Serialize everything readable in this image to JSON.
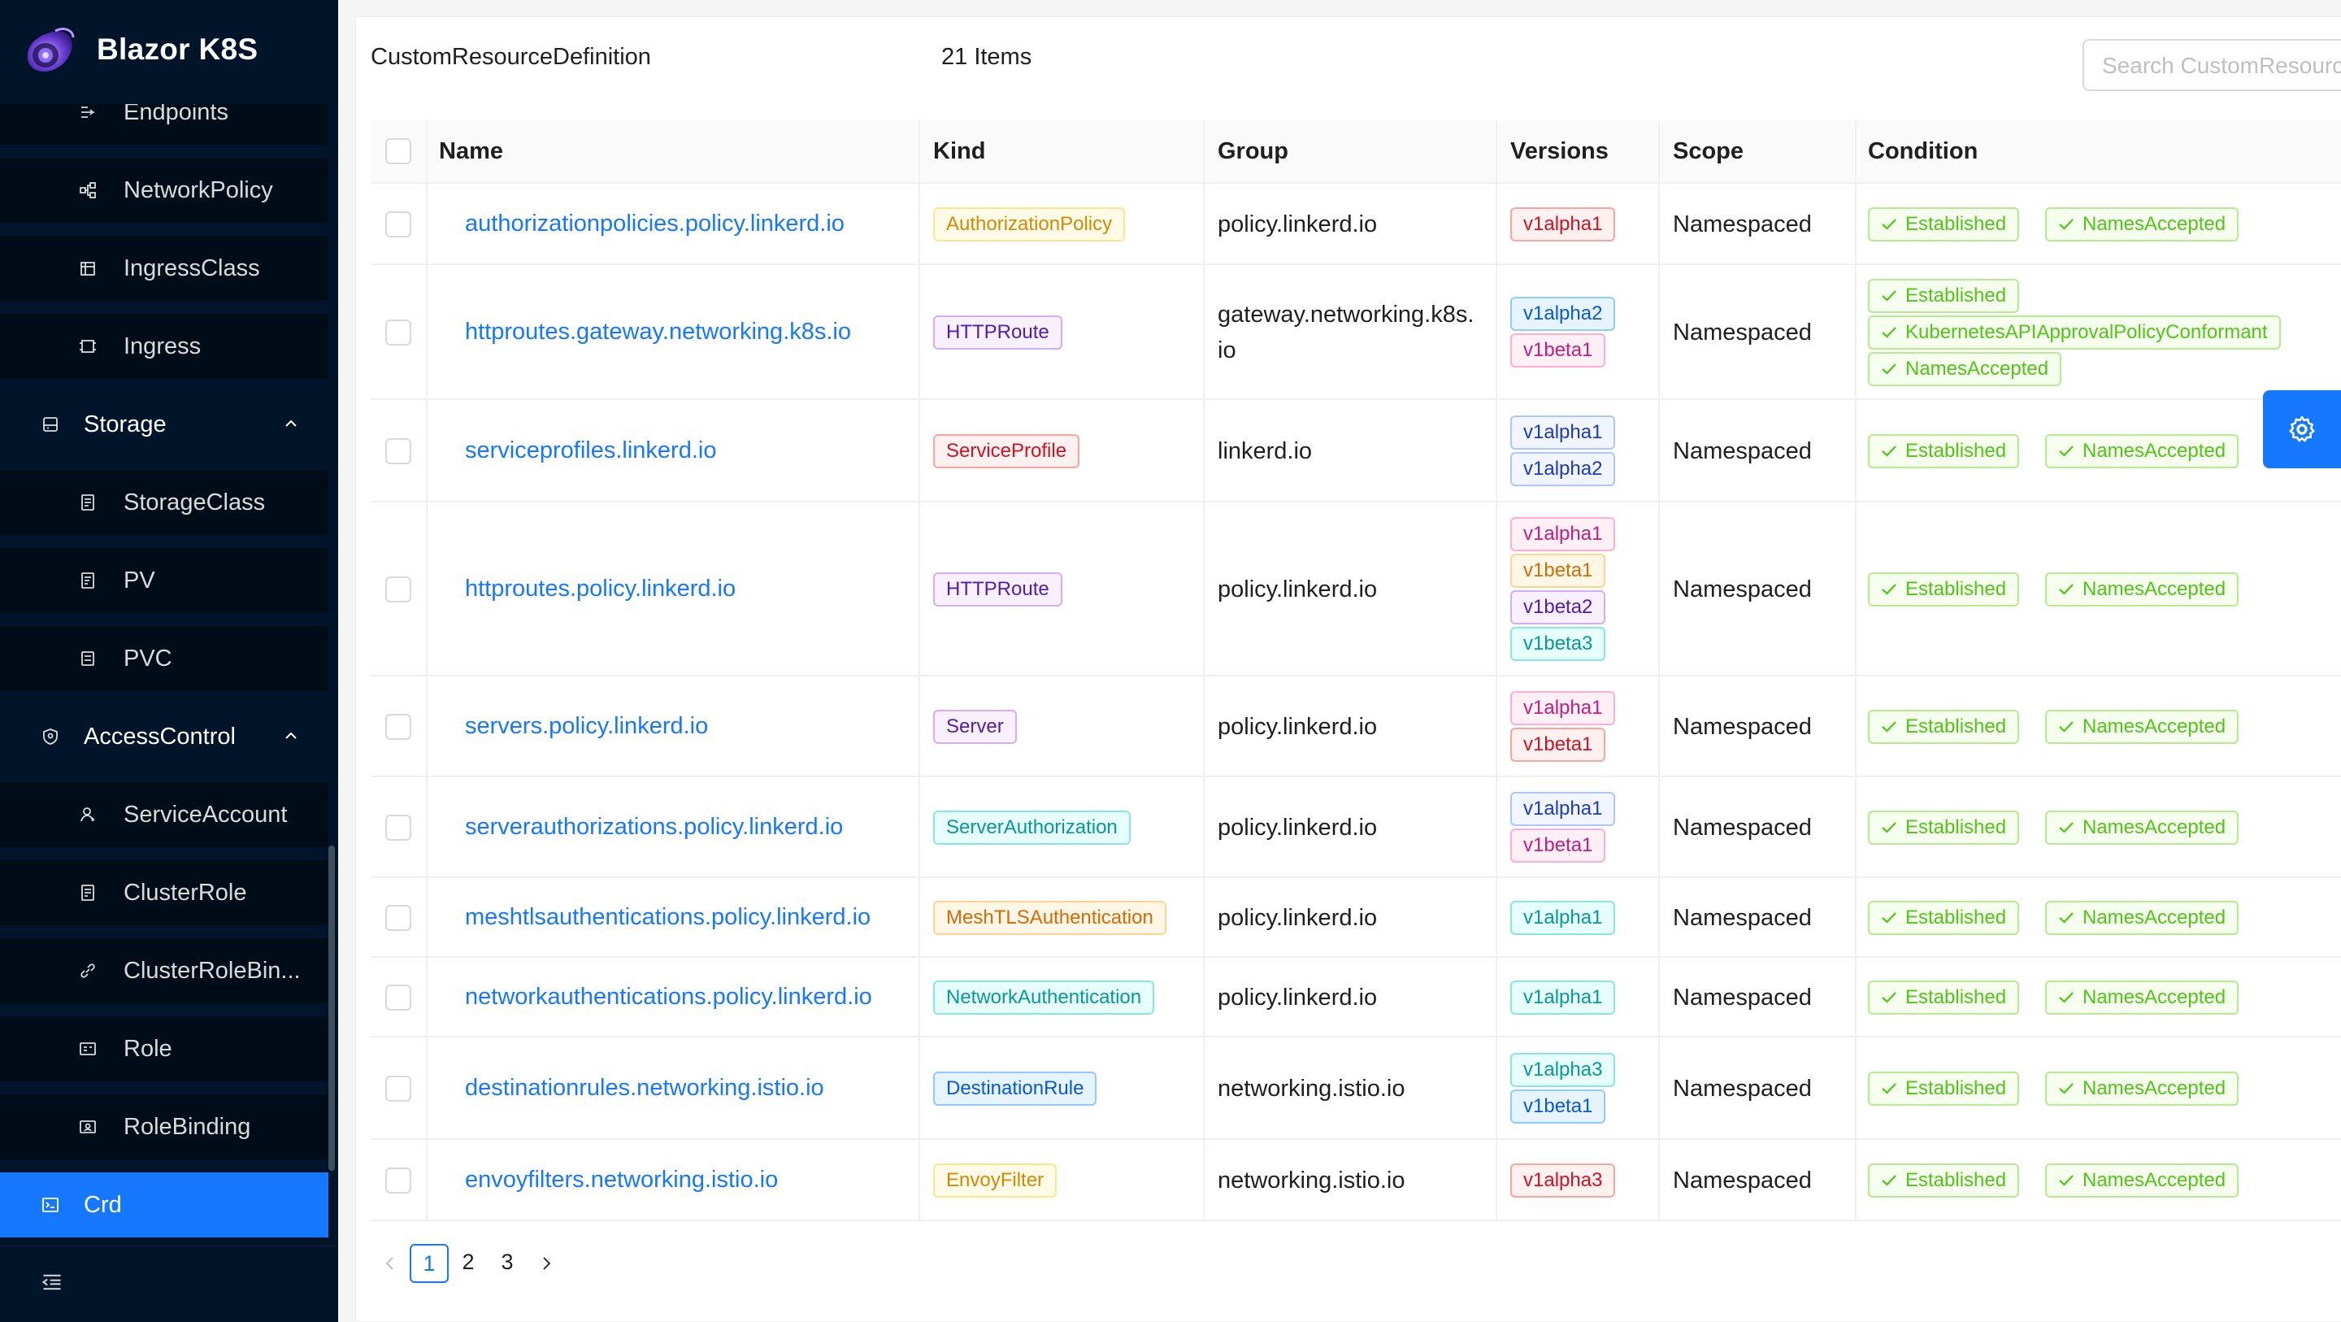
{
  "app": {
    "title": "Blazor K8S"
  },
  "sidebar": {
    "items": [
      {
        "label": "Endpoints",
        "icon": "endpoints-icon"
      },
      {
        "label": "NetworkPolicy",
        "icon": "network-policy-icon"
      },
      {
        "label": "IngressClass",
        "icon": "ingress-class-icon"
      },
      {
        "label": "Ingress",
        "icon": "ingress-icon"
      },
      {
        "label": "Storage",
        "icon": "storage-icon"
      },
      {
        "label": "StorageClass",
        "icon": "storage-class-icon"
      },
      {
        "label": "PV",
        "icon": "pv-icon"
      },
      {
        "label": "PVC",
        "icon": "pvc-icon"
      },
      {
        "label": "AccessControl",
        "icon": "access-control-icon"
      },
      {
        "label": "ServiceAccount",
        "icon": "service-account-icon"
      },
      {
        "label": "ClusterRole",
        "icon": "cluster-role-icon"
      },
      {
        "label": "ClusterRoleBin...",
        "icon": "cluster-role-binding-icon"
      },
      {
        "label": "Role",
        "icon": "role-icon"
      },
      {
        "label": "RoleBinding",
        "icon": "role-binding-icon"
      },
      {
        "label": "Crd",
        "icon": "crd-icon"
      }
    ],
    "selected": "Crd",
    "accent": "#1677ff",
    "background": "#001529"
  },
  "header": {
    "title": "CustomResourceDefinition",
    "count": "21 Items",
    "search_placeholder": "Search CustomResourceDefinition"
  },
  "table": {
    "columns": [
      "Name",
      "Kind",
      "Group",
      "Versions",
      "Scope",
      "Condition"
    ],
    "rows": [
      {
        "name": "authorizationpolicies.policy.linkerd.io",
        "kind": "AuthorizationPolicy",
        "group": [
          "policy.linkerd.io"
        ],
        "versions": [
          "v1alpha1"
        ],
        "scope": "Namespaced",
        "conditions": [
          "Established",
          "NamesAccepted"
        ]
      },
      {
        "name": "httproutes.gateway.networking.k8s.io",
        "kind": "HTTPRoute",
        "group": [
          "gateway.networking.k8s.",
          "io"
        ],
        "versions": [
          "v1alpha2",
          "v1beta1"
        ],
        "scope": "Namespaced",
        "conditions": [
          "Established",
          "KubernetesAPIApprovalPolicyConformant",
          "NamesAccepted"
        ]
      },
      {
        "name": "serviceprofiles.linkerd.io",
        "kind": "ServiceProfile",
        "group": [
          "linkerd.io"
        ],
        "versions": [
          "v1alpha1",
          "v1alpha2"
        ],
        "scope": "Namespaced",
        "conditions": [
          "Established",
          "NamesAccepted"
        ]
      },
      {
        "name": "httproutes.policy.linkerd.io",
        "kind": "HTTPRoute",
        "group": [
          "policy.linkerd.io"
        ],
        "versions": [
          "v1alpha1",
          "v1beta1",
          "v1beta2",
          "v1beta3"
        ],
        "scope": "Namespaced",
        "conditions": [
          "Established",
          "NamesAccepted"
        ]
      },
      {
        "name": "servers.policy.linkerd.io",
        "kind": "Server",
        "group": [
          "policy.linkerd.io"
        ],
        "versions": [
          "v1alpha1",
          "v1beta1"
        ],
        "scope": "Namespaced",
        "conditions": [
          "Established",
          "NamesAccepted"
        ]
      },
      {
        "name": "serverauthorizations.policy.linkerd.io",
        "kind": "ServerAuthorization",
        "group": [
          "policy.linkerd.io"
        ],
        "versions": [
          "v1alpha1",
          "v1beta1"
        ],
        "scope": "Namespaced",
        "conditions": [
          "Established",
          "NamesAccepted"
        ]
      },
      {
        "name": "meshtlsauthentications.policy.linkerd.io",
        "kind": "MeshTLSAuthentication",
        "group": [
          "policy.linkerd.io"
        ],
        "versions": [
          "v1alpha1"
        ],
        "scope": "Namespaced",
        "conditions": [
          "Established",
          "NamesAccepted"
        ]
      },
      {
        "name": "networkauthentications.policy.linkerd.io",
        "kind": "NetworkAuthentication",
        "group": [
          "policy.linkerd.io"
        ],
        "versions": [
          "v1alpha1"
        ],
        "scope": "Namespaced",
        "conditions": [
          "Established",
          "NamesAccepted"
        ]
      },
      {
        "name": "destinationrules.networking.istio.io",
        "kind": "DestinationRule",
        "group": [
          "networking.istio.io"
        ],
        "versions": [
          "v1alpha3",
          "v1beta1"
        ],
        "scope": "Namespaced",
        "conditions": [
          "Established",
          "NamesAccepted"
        ]
      },
      {
        "name": "envoyfilters.networking.istio.io",
        "kind": "EnvoyFilter",
        "group": [
          "networking.istio.io"
        ],
        "versions": [
          "v1alpha3"
        ],
        "scope": "Namespaced",
        "conditions": [
          "Established",
          "NamesAccepted"
        ]
      }
    ]
  },
  "pagination": {
    "pages": [
      "1",
      "2",
      "3"
    ],
    "current": "1"
  }
}
